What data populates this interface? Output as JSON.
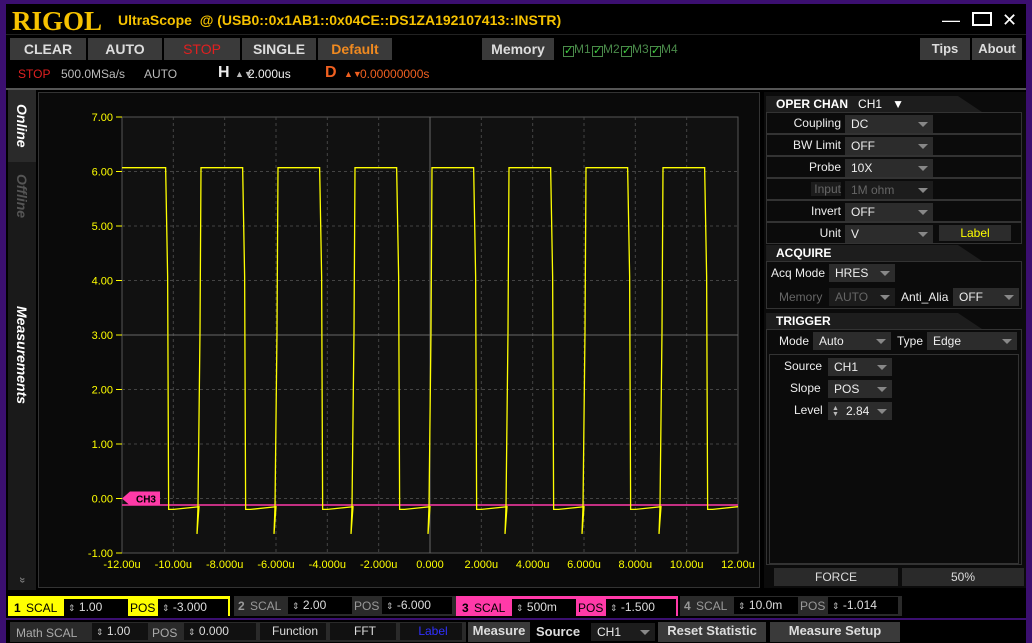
{
  "app": {
    "logo": "RIGOL",
    "title": "UltraScope",
    "instrument": "@ (USB0::0x1AB1::0x04CE::DS1ZA192107413::INSTR)"
  },
  "window": {
    "minimize": "—",
    "maximize": "☐",
    "close": "✕"
  },
  "toolbar": {
    "clear": "CLEAR",
    "auto": "AUTO",
    "stop": "STOP",
    "single": "SINGLE",
    "default": "Default",
    "memory": "Memory",
    "m1": "M1",
    "m2": "M2",
    "m3": "M3",
    "m4": "M4",
    "tips": "Tips",
    "about": "About"
  },
  "status": {
    "run": "STOP",
    "rate": "500.0MSa/s",
    "mode": "AUTO",
    "h_label": "H",
    "h_value": "2.000us",
    "d_label": "D",
    "d_value": "0.00000000s"
  },
  "tabs": {
    "online": "Online",
    "offline": "Offline",
    "measurements": "Measurements"
  },
  "oper_chan": {
    "title": "OPER CHAN",
    "channel": "CH1",
    "coupling_label": "Coupling",
    "coupling": "DC",
    "bw_label": "BW Limit",
    "bw": "OFF",
    "probe_label": "Probe",
    "probe": "10X",
    "input_label": "Input",
    "input": "1M ohm",
    "invert_label": "Invert",
    "invert": "OFF",
    "unit_label": "Unit",
    "unit": "V",
    "label_btn": "Label"
  },
  "acquire": {
    "title": "ACQUIRE",
    "mode_label": "Acq Mode",
    "mode": "HRES",
    "memory_label": "Memory",
    "memory": "AUTO",
    "anti_label": "Anti_Alia",
    "anti": "OFF"
  },
  "trigger": {
    "title": "TRIGGER",
    "mode_label": "Mode",
    "mode": "Auto",
    "type_label": "Type",
    "type": "Edge",
    "source_label": "Source",
    "source": "CH1",
    "slope_label": "Slope",
    "slope": "POS",
    "level_label": "Level",
    "level": "2.84",
    "force": "FORCE",
    "fifty": "50%"
  },
  "channels": [
    {
      "num": "1",
      "scal_label": "SCAL",
      "scal": "1.00",
      "pos_label": "POS",
      "pos": "-3.000",
      "color": "#ffff00"
    },
    {
      "num": "2",
      "scal_label": "SCAL",
      "scal": "2.00",
      "pos_label": "POS",
      "pos": "-6.000",
      "color": "#444444"
    },
    {
      "num": "3",
      "scal_label": "SCAL",
      "scal": "500m",
      "pos_label": "POS",
      "pos": "-1.500",
      "color": "#ff3aa8"
    },
    {
      "num": "4",
      "scal_label": "SCAL",
      "scal": "10.0m",
      "pos_label": "POS",
      "pos": "-1.014",
      "color": "#444444"
    }
  ],
  "math": {
    "scal_label": "Math SCAL",
    "scal": "1.00",
    "pos_label": "POS",
    "pos": "0.000",
    "function": "Function",
    "fft": "FFT",
    "label": "Label"
  },
  "measure": {
    "measure": "Measure",
    "source_label": "Source",
    "source": "CH1",
    "reset": "Reset  Statistic",
    "setup": "Measure Setup"
  },
  "chart_data": {
    "type": "line",
    "xlim": [
      -12,
      12
    ],
    "ylim": [
      -1,
      7
    ],
    "x_ticks": [
      "-12.00u",
      "-10.00u",
      "-8.000u",
      "-6.000u",
      "-4.000u",
      "-2.000u",
      "0.000",
      "2.000u",
      "4.000u",
      "6.000u",
      "8.000u",
      "10.00u",
      "12.00u"
    ],
    "y_ticks": [
      "7.00",
      "6.00",
      "5.00",
      "4.00",
      "3.00",
      "2.00",
      "1.00",
      "0.00",
      "-1.00"
    ],
    "grid": true,
    "series": [
      {
        "name": "CH1",
        "color": "#ffff00",
        "high": 6.07,
        "low": -0.15,
        "rising_edges": [
          -9,
          -6,
          -3,
          0,
          3,
          6,
          9
        ],
        "falling_edges": [
          -10.3,
          -7.3,
          -4.3,
          -1.3,
          1.7,
          4.7,
          7.7,
          10.7
        ]
      },
      {
        "name": "CH3",
        "color": "#ff3aa8",
        "level": -0.12
      }
    ],
    "marker": {
      "label": "CH3",
      "level": 0.0
    }
  }
}
